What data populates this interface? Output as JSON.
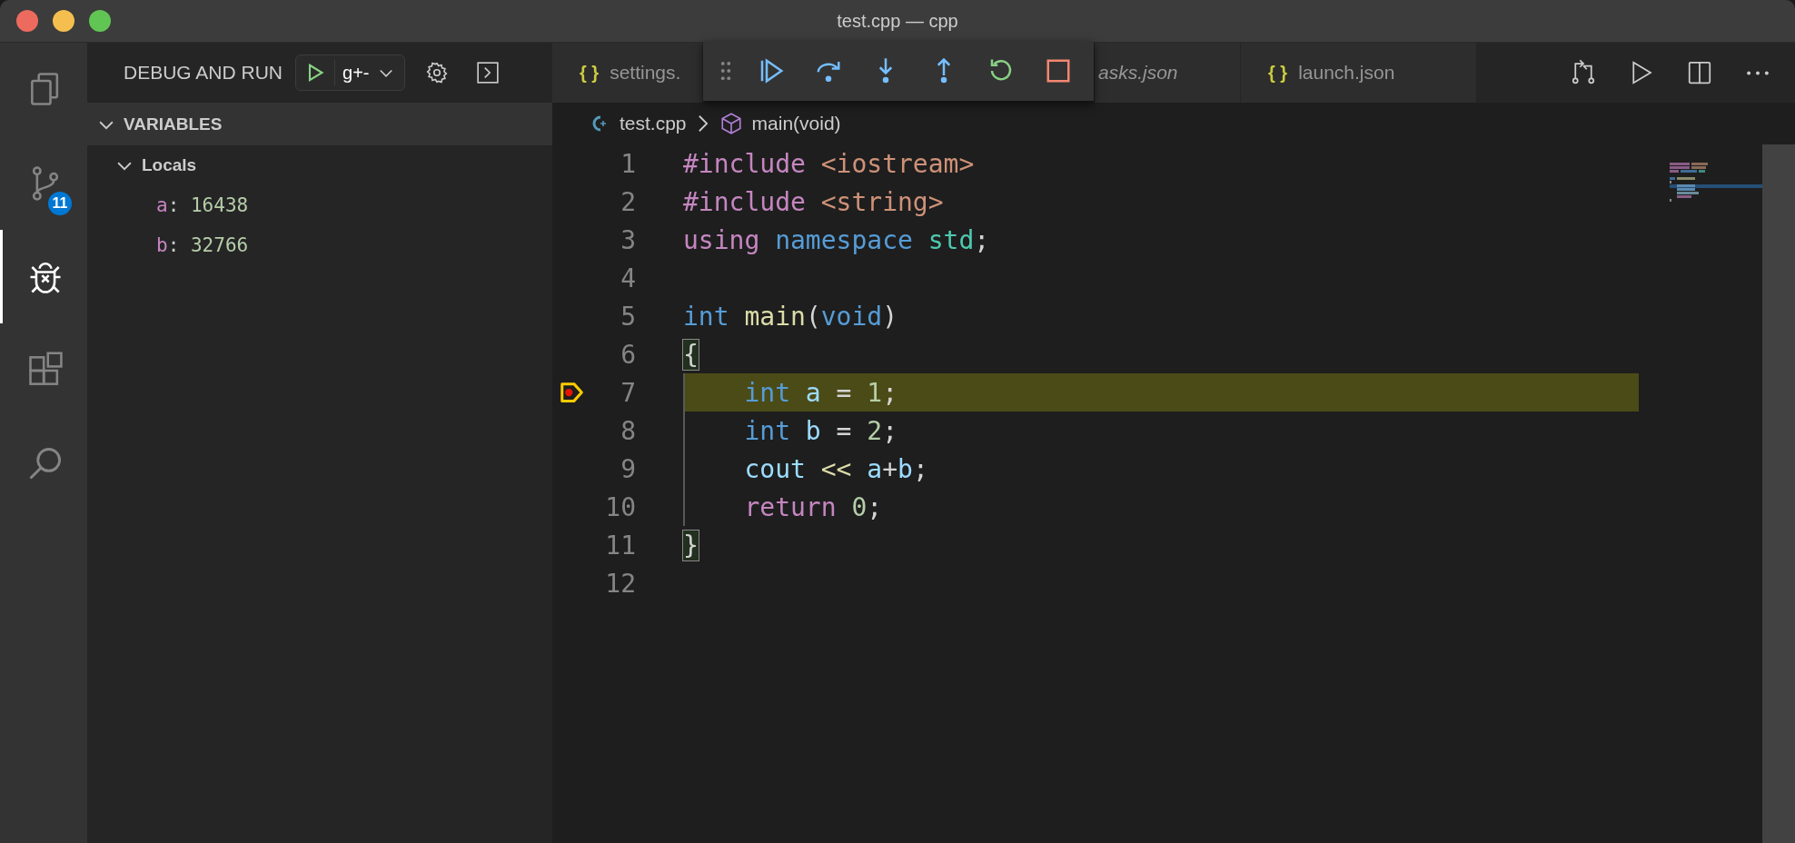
{
  "window": {
    "title": "test.cpp — cpp"
  },
  "activity_bar": {
    "items": [
      {
        "kind": "files",
        "selected": false
      },
      {
        "kind": "source-control",
        "selected": false,
        "badge": "11"
      },
      {
        "kind": "debug",
        "selected": true
      },
      {
        "kind": "extensions",
        "selected": false
      },
      {
        "kind": "search",
        "selected": false
      }
    ]
  },
  "sidebar": {
    "title": "DEBUG AND RUN",
    "configuration": "g+-",
    "variables": {
      "title": "VARIABLES",
      "expanded": true,
      "scopes": [
        {
          "name": "Locals",
          "expanded": true,
          "children": [
            {
              "name": "a",
              "separator": ":",
              "value": "16438"
            },
            {
              "name": "b",
              "separator": ":",
              "value": "32766"
            }
          ]
        }
      ]
    }
  },
  "tabs": [
    {
      "icon_text": "{ }",
      "label": "settings.",
      "preview": false
    },
    {
      "label": "asks.json",
      "preview": true
    },
    {
      "icon_text": "{ }",
      "label": "launch.json",
      "preview": false
    }
  ],
  "debug_toolbar": {
    "buttons": [
      {
        "kind": "gripper"
      },
      {
        "kind": "continue"
      },
      {
        "kind": "step-over"
      },
      {
        "kind": "step-into"
      },
      {
        "kind": "step-out"
      },
      {
        "kind": "restart"
      },
      {
        "kind": "stop"
      }
    ]
  },
  "breadcrumb": [
    {
      "kind": "file",
      "text": "test.cpp"
    },
    {
      "kind": "symbol",
      "text": "main(void)"
    }
  ],
  "code": {
    "lines": [
      {
        "number": "1",
        "current": false,
        "indented": false,
        "tokens": [
          {
            "text": "#include",
            "kind": "keyword"
          },
          {
            "text": " <iostream>",
            "kind": "string"
          }
        ]
      },
      {
        "number": "2",
        "current": false,
        "indented": false,
        "tokens": [
          {
            "text": "#include",
            "kind": "keyword"
          },
          {
            "text": " <string>",
            "kind": "string"
          }
        ]
      },
      {
        "number": "3",
        "current": false,
        "indented": false,
        "tokens": [
          {
            "text": "using",
            "kind": "keyword"
          },
          {
            "text": " namespace",
            "kind": "storage"
          },
          {
            "text": " std",
            "kind": "type"
          },
          {
            "text": ";",
            "kind": "plain"
          }
        ]
      },
      {
        "number": "4",
        "current": false,
        "indented": false
      },
      {
        "number": "5",
        "current": false,
        "indented": false,
        "tokens": [
          {
            "text": "int",
            "kind": "storage"
          },
          {
            "text": " main",
            "kind": "function"
          },
          {
            "text": "(",
            "kind": "plain"
          },
          {
            "text": "void",
            "kind": "storage"
          },
          {
            "text": ")",
            "kind": "plain"
          }
        ]
      },
      {
        "number": "6",
        "current": false,
        "indented": false,
        "tokens": [
          {
            "text": "{",
            "kind": "bracket-match"
          }
        ]
      },
      {
        "number": "7",
        "current": true,
        "indented": true,
        "tokens": [
          {
            "text": "int",
            "kind": "storage"
          },
          {
            "text": " a",
            "kind": "variable"
          },
          {
            "text": " =",
            "kind": "plain"
          },
          {
            "text": " 1",
            "kind": "number"
          },
          {
            "text": ";",
            "kind": "plain"
          }
        ]
      },
      {
        "number": "8",
        "current": false,
        "indented": true,
        "tokens": [
          {
            "text": "int",
            "kind": "storage"
          },
          {
            "text": " b",
            "kind": "variable"
          },
          {
            "text": " =",
            "kind": "plain"
          },
          {
            "text": " 2",
            "kind": "number"
          },
          {
            "text": ";",
            "kind": "plain"
          }
        ]
      },
      {
        "number": "9",
        "current": false,
        "indented": true,
        "tokens": [
          {
            "text": "cout",
            "kind": "variable"
          },
          {
            "text": " <<",
            "kind": "function"
          },
          {
            "text": " a",
            "kind": "variable"
          },
          {
            "text": "+",
            "kind": "plain"
          },
          {
            "text": "b",
            "kind": "variable"
          },
          {
            "text": ";",
            "kind": "plain"
          }
        ]
      },
      {
        "number": "10",
        "current": false,
        "indented": true,
        "tokens": [
          {
            "text": "return",
            "kind": "keyword"
          },
          {
            "text": " 0",
            "kind": "number"
          },
          {
            "text": ";",
            "kind": "plain"
          }
        ]
      },
      {
        "number": "11",
        "current": false,
        "indented": false,
        "tokens": [
          {
            "text": "}",
            "kind": "bracket-match"
          }
        ]
      },
      {
        "number": "12",
        "current": false,
        "indented": false
      }
    ]
  }
}
